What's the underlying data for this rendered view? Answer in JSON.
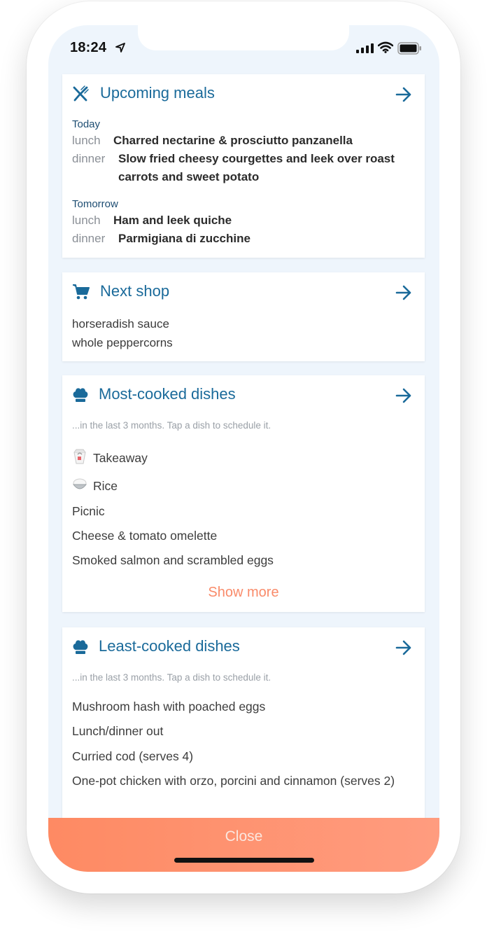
{
  "status_bar": {
    "time": "18:24"
  },
  "colors": {
    "accent": "#1a6a9a",
    "action": "#fe8a63",
    "background": "#eef5fc"
  },
  "upcoming_meals": {
    "title": "Upcoming meals",
    "icon": "cutlery-icon",
    "days": [
      {
        "label": "Today",
        "meals": [
          {
            "type": "lunch",
            "name": "Charred nectarine & prosciutto panzanella"
          },
          {
            "type": "dinner",
            "name": "Slow fried cheesy courgettes and leek over roast carrots and sweet potato"
          }
        ]
      },
      {
        "label": "Tomorrow",
        "meals": [
          {
            "type": "lunch",
            "name": "Ham and leek quiche"
          },
          {
            "type": "dinner",
            "name": "Parmigiana di zucchine"
          }
        ]
      }
    ]
  },
  "next_shop": {
    "title": "Next shop",
    "icon": "cart-icon",
    "items": [
      "horseradish sauce",
      "whole peppercorns"
    ]
  },
  "most_cooked": {
    "title": "Most-cooked dishes",
    "icon": "chef-hat-icon",
    "note": "...in the last 3 months. Tap a dish to schedule it.",
    "dishes": [
      {
        "emoji": "🥡",
        "name": "Takeaway"
      },
      {
        "emoji": "🍚",
        "name": "Rice"
      },
      {
        "emoji": "",
        "name": "Picnic"
      },
      {
        "emoji": "",
        "name": "Cheese & tomato omelette"
      },
      {
        "emoji": "",
        "name": "Smoked salmon and scrambled eggs"
      }
    ],
    "show_more": "Show more"
  },
  "least_cooked": {
    "title": "Least-cooked dishes",
    "icon": "chef-hat-icon",
    "note": "...in the last 3 months. Tap a dish to schedule it.",
    "dishes": [
      {
        "name": "Mushroom hash with poached eggs"
      },
      {
        "name": "Lunch/dinner out"
      },
      {
        "name": "Curried cod (serves 4)"
      },
      {
        "name": "One-pot chicken with orzo, porcini and cinnamon (serves 2)"
      }
    ]
  },
  "close_button": {
    "label": "Close"
  }
}
